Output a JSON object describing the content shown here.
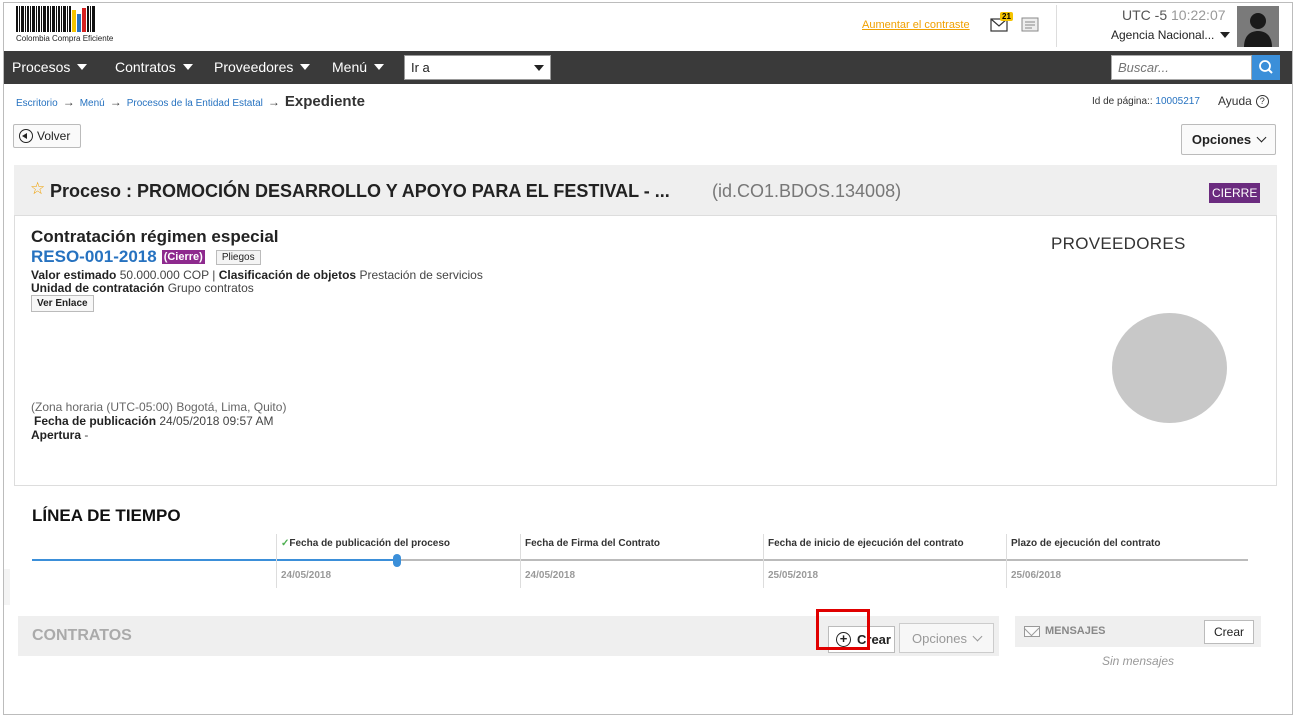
{
  "header": {
    "logo_text": "Colombia Compra Eficiente",
    "contrast_link": "Aumentar el contraste",
    "mail_count": "21",
    "timezone": "UTC -5",
    "time": "10:22:07",
    "agency": "Agencia Nacional..."
  },
  "nav": {
    "items": [
      "Procesos",
      "Contratos",
      "Proveedores",
      "Menú"
    ],
    "goto_value": "Ir a",
    "search_placeholder": "Buscar..."
  },
  "breadcrumb": {
    "items": [
      "Escritorio",
      "Menú",
      "Procesos de la Entidad Estatal"
    ],
    "current": "Expediente",
    "page_id_label": "Id de página::",
    "page_id": "10005217",
    "help_label": "Ayuda"
  },
  "toolbar": {
    "back_label": "Volver",
    "options_label": "Opciones"
  },
  "process": {
    "title": "Proceso : PROMOCIÓN DESARROLLO Y APOYO PARA EL FESTIVAL - ...",
    "id": "(id.CO1.BDOS.134008)",
    "status_badge": "CIERRE",
    "type": "Contratación régimen especial",
    "reference": "RESO-001-2018",
    "state_tag": "(Cierre)",
    "pliegos_button": "Pliegos",
    "estimated_label": "Valor estimado",
    "estimated_value": "50.000.000 COP",
    "classification_label": "Clasificación de objetos",
    "classification_value": "Prestación de servicios",
    "unit_label": "Unidad de contratación",
    "unit_value": "Grupo contratos",
    "link_button": "Ver Enlace",
    "timezone_info": "(Zona horaria (UTC-05:00) Bogotá, Lima, Quito)",
    "publication_label": "Fecha de publicación",
    "publication_value": "24/05/2018 09:57 AM",
    "opening_label": "Apertura",
    "opening_value": "-",
    "providers_title": "PROVEEDORES"
  },
  "timeline": {
    "title": "LÍNEA DE TIEMPO",
    "progress_fraction": 0.3,
    "milestones": [
      {
        "label": "Fecha de publicación del proceso",
        "date": "24/05/2018",
        "done": true
      },
      {
        "label": "Fecha de Firma del Contrato",
        "date": "24/05/2018",
        "done": false
      },
      {
        "label": "Fecha de inicio de ejecución del contrato",
        "date": "25/05/2018",
        "done": false
      },
      {
        "label": "Plazo de ejecución del contrato",
        "date": "25/06/2018",
        "done": false
      }
    ]
  },
  "contracts": {
    "title": "CONTRATOS",
    "create_label": "Crear",
    "options_label": "Opciones"
  },
  "messages": {
    "title": "MENSAJES",
    "create_label": "Crear",
    "empty_text": "Sin mensajes"
  },
  "colors": {
    "accent": "#2672c0",
    "navbar": "#3a3a3a",
    "status_purple": "#6b2b7f",
    "highlight_red": "#e00000"
  }
}
